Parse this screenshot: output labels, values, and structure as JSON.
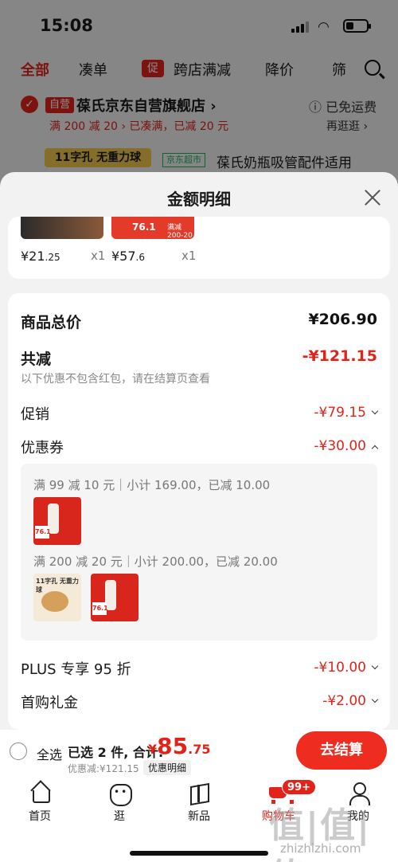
{
  "status": {
    "time": "15:08"
  },
  "background": {
    "tabs": [
      "全部",
      "凑单",
      "跨店满减",
      "降价",
      "筛"
    ],
    "tab_badge": "促",
    "shop_self_badge": "自营",
    "shop_name": "葆氏京东自营旗舰店 ›",
    "free_shipping": "ⓘ 已免运费",
    "promo_line": "满 200 减 20 › 已凑满，已减 20 元",
    "promo_more": "再逛逛 ›",
    "product_tag": "11字孔 无重力球",
    "jd_super_label": "京东超市",
    "product_title": "葆氏奶瓶吸管配件适用"
  },
  "sheet": {
    "title": "金额明细",
    "items": [
      {
        "price_int": "¥21",
        "price_dec": ".25",
        "qty": "x1",
        "thumb_tag": "",
        "thumb_tag2": ""
      },
      {
        "price_int": "¥57",
        "price_dec": ".6",
        "qty": "x1",
        "thumb_tag": "76.1",
        "thumb_tag2": "满减200-20"
      }
    ],
    "summary": {
      "goods_total_label": "商品总价",
      "goods_total_value": "¥206.90",
      "total_cut_label": "共减",
      "total_cut_value": "-¥121.15",
      "note": "以下优惠不包含红包，请在结算页查看",
      "promo_label": "促销",
      "promo_value": "-¥79.15",
      "coupon_label": "优惠券",
      "coupon_value": "-¥30.00",
      "plus_label": "PLUS 专享 95 折",
      "plus_value": "-¥10.00",
      "first_gift_label": "首购礼金",
      "first_gift_value": "-¥2.00"
    },
    "coupon_details": [
      {
        "text": "满 99 减 10 元｜小计 169.00，已减 10.00"
      },
      {
        "text": "满 200 减 20 元｜小计 200.00，已减 20.00"
      }
    ],
    "coupon_thumb_labels": {
      "red_p": "76.1",
      "cream_t": "11字孔 无重力球"
    }
  },
  "bottom_bar": {
    "select_all": "全选",
    "selected_text": "已选 2 件, 合计:",
    "price_currency": "¥",
    "price_int": "85",
    "price_dec": ".75",
    "discount_text": "优惠减:¥121.15",
    "detail_link": "优惠明细",
    "checkout": "去结算"
  },
  "tabbar": {
    "items": [
      "首页",
      "逛",
      "新品",
      "购物车",
      "我的"
    ],
    "cart_badge": "99+"
  },
  "watermark": {
    "mark": "值|值|值",
    "url": "zhizhizhi.com"
  },
  "colors": {
    "accent": "#e2231a",
    "checkout": "#ee2d20"
  }
}
